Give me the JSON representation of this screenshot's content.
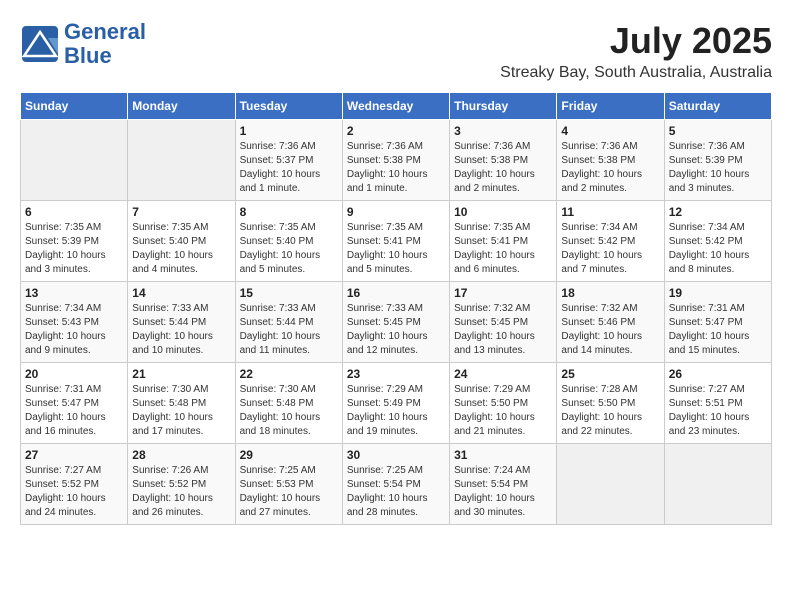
{
  "header": {
    "logo_text_top": "General",
    "logo_text_bottom": "Blue",
    "month_title": "July 2025",
    "location": "Streaky Bay, South Australia, Australia"
  },
  "weekdays": [
    "Sunday",
    "Monday",
    "Tuesday",
    "Wednesday",
    "Thursday",
    "Friday",
    "Saturday"
  ],
  "weeks": [
    [
      {
        "day": "",
        "info": ""
      },
      {
        "day": "",
        "info": ""
      },
      {
        "day": "1",
        "info": "Sunrise: 7:36 AM\nSunset: 5:37 PM\nDaylight: 10 hours and 1 minute."
      },
      {
        "day": "2",
        "info": "Sunrise: 7:36 AM\nSunset: 5:38 PM\nDaylight: 10 hours and 1 minute."
      },
      {
        "day": "3",
        "info": "Sunrise: 7:36 AM\nSunset: 5:38 PM\nDaylight: 10 hours and 2 minutes."
      },
      {
        "day": "4",
        "info": "Sunrise: 7:36 AM\nSunset: 5:38 PM\nDaylight: 10 hours and 2 minutes."
      },
      {
        "day": "5",
        "info": "Sunrise: 7:36 AM\nSunset: 5:39 PM\nDaylight: 10 hours and 3 minutes."
      }
    ],
    [
      {
        "day": "6",
        "info": "Sunrise: 7:35 AM\nSunset: 5:39 PM\nDaylight: 10 hours and 3 minutes."
      },
      {
        "day": "7",
        "info": "Sunrise: 7:35 AM\nSunset: 5:40 PM\nDaylight: 10 hours and 4 minutes."
      },
      {
        "day": "8",
        "info": "Sunrise: 7:35 AM\nSunset: 5:40 PM\nDaylight: 10 hours and 5 minutes."
      },
      {
        "day": "9",
        "info": "Sunrise: 7:35 AM\nSunset: 5:41 PM\nDaylight: 10 hours and 5 minutes."
      },
      {
        "day": "10",
        "info": "Sunrise: 7:35 AM\nSunset: 5:41 PM\nDaylight: 10 hours and 6 minutes."
      },
      {
        "day": "11",
        "info": "Sunrise: 7:34 AM\nSunset: 5:42 PM\nDaylight: 10 hours and 7 minutes."
      },
      {
        "day": "12",
        "info": "Sunrise: 7:34 AM\nSunset: 5:42 PM\nDaylight: 10 hours and 8 minutes."
      }
    ],
    [
      {
        "day": "13",
        "info": "Sunrise: 7:34 AM\nSunset: 5:43 PM\nDaylight: 10 hours and 9 minutes."
      },
      {
        "day": "14",
        "info": "Sunrise: 7:33 AM\nSunset: 5:44 PM\nDaylight: 10 hours and 10 minutes."
      },
      {
        "day": "15",
        "info": "Sunrise: 7:33 AM\nSunset: 5:44 PM\nDaylight: 10 hours and 11 minutes."
      },
      {
        "day": "16",
        "info": "Sunrise: 7:33 AM\nSunset: 5:45 PM\nDaylight: 10 hours and 12 minutes."
      },
      {
        "day": "17",
        "info": "Sunrise: 7:32 AM\nSunset: 5:45 PM\nDaylight: 10 hours and 13 minutes."
      },
      {
        "day": "18",
        "info": "Sunrise: 7:32 AM\nSunset: 5:46 PM\nDaylight: 10 hours and 14 minutes."
      },
      {
        "day": "19",
        "info": "Sunrise: 7:31 AM\nSunset: 5:47 PM\nDaylight: 10 hours and 15 minutes."
      }
    ],
    [
      {
        "day": "20",
        "info": "Sunrise: 7:31 AM\nSunset: 5:47 PM\nDaylight: 10 hours and 16 minutes."
      },
      {
        "day": "21",
        "info": "Sunrise: 7:30 AM\nSunset: 5:48 PM\nDaylight: 10 hours and 17 minutes."
      },
      {
        "day": "22",
        "info": "Sunrise: 7:30 AM\nSunset: 5:48 PM\nDaylight: 10 hours and 18 minutes."
      },
      {
        "day": "23",
        "info": "Sunrise: 7:29 AM\nSunset: 5:49 PM\nDaylight: 10 hours and 19 minutes."
      },
      {
        "day": "24",
        "info": "Sunrise: 7:29 AM\nSunset: 5:50 PM\nDaylight: 10 hours and 21 minutes."
      },
      {
        "day": "25",
        "info": "Sunrise: 7:28 AM\nSunset: 5:50 PM\nDaylight: 10 hours and 22 minutes."
      },
      {
        "day": "26",
        "info": "Sunrise: 7:27 AM\nSunset: 5:51 PM\nDaylight: 10 hours and 23 minutes."
      }
    ],
    [
      {
        "day": "27",
        "info": "Sunrise: 7:27 AM\nSunset: 5:52 PM\nDaylight: 10 hours and 24 minutes."
      },
      {
        "day": "28",
        "info": "Sunrise: 7:26 AM\nSunset: 5:52 PM\nDaylight: 10 hours and 26 minutes."
      },
      {
        "day": "29",
        "info": "Sunrise: 7:25 AM\nSunset: 5:53 PM\nDaylight: 10 hours and 27 minutes."
      },
      {
        "day": "30",
        "info": "Sunrise: 7:25 AM\nSunset: 5:54 PM\nDaylight: 10 hours and 28 minutes."
      },
      {
        "day": "31",
        "info": "Sunrise: 7:24 AM\nSunset: 5:54 PM\nDaylight: 10 hours and 30 minutes."
      },
      {
        "day": "",
        "info": ""
      },
      {
        "day": "",
        "info": ""
      }
    ]
  ]
}
